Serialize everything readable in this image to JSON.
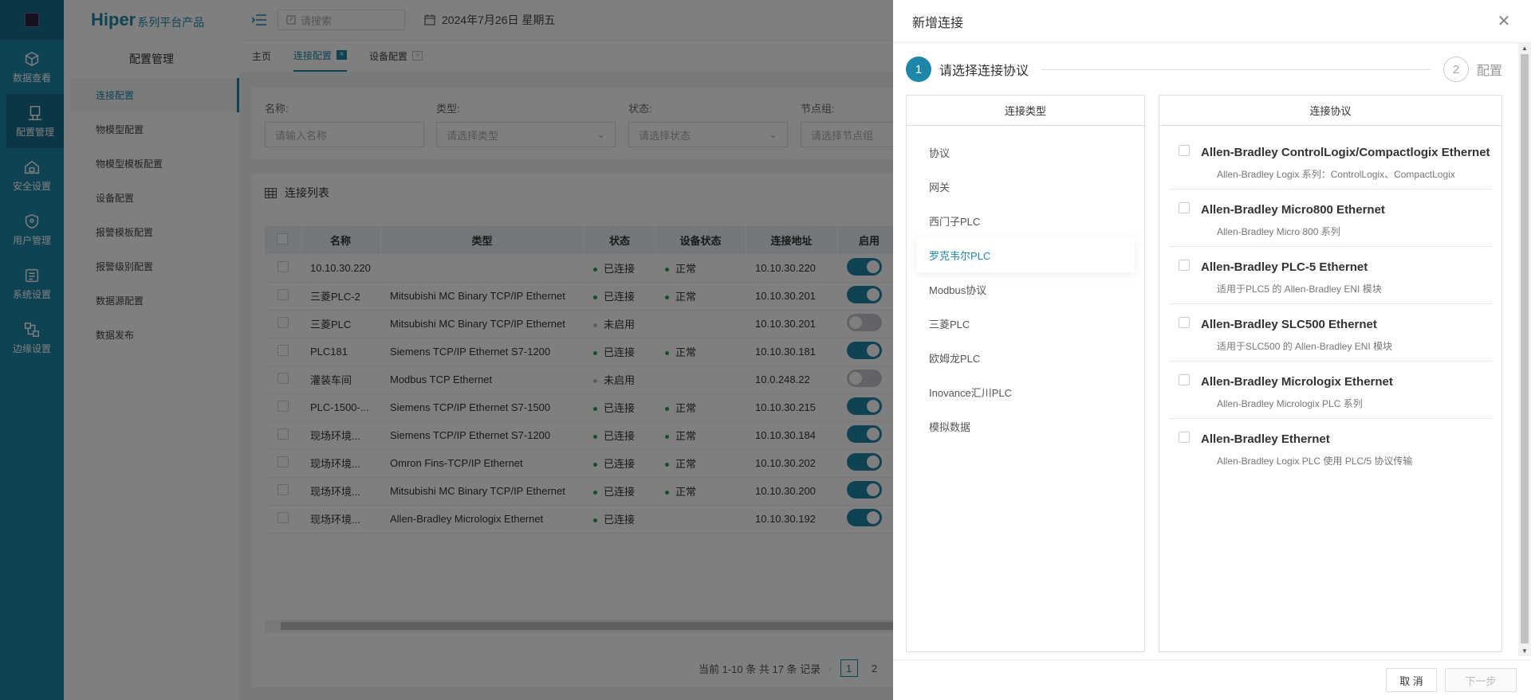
{
  "rail": {
    "items": [
      {
        "label": "数据查看",
        "icon": "cube-icon"
      },
      {
        "label": "配置管理",
        "icon": "config-icon"
      },
      {
        "label": "安全设置",
        "icon": "home-lock-icon"
      },
      {
        "label": "用户管理",
        "icon": "shield-icon"
      },
      {
        "label": "系统设置",
        "icon": "system-icon"
      },
      {
        "label": "边缘设置",
        "icon": "edge-icon"
      }
    ]
  },
  "brand": {
    "main": "Hiper",
    "sub": "系列平台产品"
  },
  "sidebar": {
    "title": "配置管理",
    "items": [
      {
        "label": "连接配置"
      },
      {
        "label": "物模型配置"
      },
      {
        "label": "物模型模板配置"
      },
      {
        "label": "设备配置"
      },
      {
        "label": "报警模板配置"
      },
      {
        "label": "报警级别配置"
      },
      {
        "label": "数据源配置"
      },
      {
        "label": "数据发布"
      }
    ]
  },
  "header": {
    "search_placeholder": "请搜索",
    "date": "2024年7月26日 星期五"
  },
  "tabs": [
    {
      "label": "主页"
    },
    {
      "label": "连接配置"
    },
    {
      "label": "设备配置"
    }
  ],
  "filters": {
    "name_label": "名称:",
    "name_placeholder": "请输入名称",
    "type_label": "类型:",
    "type_placeholder": "请选择类型",
    "status_label": "状态:",
    "status_placeholder": "请选择状态",
    "group_label": "节点组:",
    "group_placeholder": "请选择节点组"
  },
  "list": {
    "title": "连接列表",
    "columns": [
      "名称",
      "类型",
      "状态",
      "设备状态",
      "连接地址",
      "启用"
    ],
    "rows": [
      {
        "name": "10.10.30.220",
        "type": "",
        "status": "已连接",
        "dev": "正常",
        "addr": "10.10.30.220",
        "on": true
      },
      {
        "name": "三菱PLC-2",
        "type": "Mitsubishi MC Binary TCP/IP Ethernet",
        "status": "已连接",
        "dev": "正常",
        "addr": "10.10.30.201",
        "on": true
      },
      {
        "name": "三菱PLC",
        "type": "Mitsubishi MC Binary TCP/IP Ethernet",
        "status": "未启用",
        "dev": "",
        "addr": "10.10.30.201",
        "on": false
      },
      {
        "name": "PLC181",
        "type": "Siemens TCP/IP Ethernet S7-1200",
        "status": "已连接",
        "dev": "正常",
        "addr": "10.10.30.181",
        "on": true
      },
      {
        "name": "灌装车间",
        "type": "Modbus TCP Ethernet",
        "status": "未启用",
        "dev": "",
        "addr": "10.0.248.22",
        "on": false
      },
      {
        "name": "PLC-1500-...",
        "type": "Siemens TCP/IP Ethernet S7-1500",
        "status": "已连接",
        "dev": "正常",
        "addr": "10.10.30.215",
        "on": true
      },
      {
        "name": "现场环境...",
        "type": "Siemens TCP/IP Ethernet S7-1200",
        "status": "已连接",
        "dev": "正常",
        "addr": "10.10.30.184",
        "on": true
      },
      {
        "name": "现场环境...",
        "type": "Omron Fins-TCP/IP Ethernet",
        "status": "已连接",
        "dev": "正常",
        "addr": "10.10.30.202",
        "on": true
      },
      {
        "name": "现场环境...",
        "type": "Mitsubishi MC Binary TCP/IP Ethernet",
        "status": "已连接",
        "dev": "正常",
        "addr": "10.10.30.200",
        "on": true
      },
      {
        "name": "现场环境...",
        "type": "Allen-Bradley Micrologix Ethernet",
        "status": "已连接",
        "dev": "",
        "addr": "10.10.30.192",
        "on": true
      }
    ],
    "pager_text": "当前 1-10 条 共 17 条 记录",
    "pages": [
      "1",
      "2"
    ]
  },
  "drawer": {
    "title": "新增连接",
    "step1_num": "1",
    "step1_label": "请选择连接协议",
    "step2_num": "2",
    "step2_label": "配置",
    "type_header": "连接类型",
    "proto_header": "连接协议",
    "types": [
      "协议",
      "网关",
      "西门子PLC",
      "罗克韦尔PLC",
      "Modbus协议",
      "三菱PLC",
      "欧姆龙PLC",
      "Inovance汇川PLC",
      "模拟数据"
    ],
    "active_type_index": 3,
    "protocols": [
      {
        "name": "Allen-Bradley ControlLogix/Compactlogix Ethernet",
        "desc": "Allen-Bradley Logix 系列：ControlLogix、CompactLogix"
      },
      {
        "name": "Allen-Bradley Micro800 Ethernet",
        "desc": "Allen-Bradley Micro 800 系列"
      },
      {
        "name": "Allen-Bradley PLC-5 Ethernet",
        "desc": "适用于PLC5 的 Allen-Bradley ENI 模块"
      },
      {
        "name": "Allen-Bradley SLC500 Ethernet",
        "desc": "适用于SLC500 的 Allen-Bradley ENI 模块"
      },
      {
        "name": "Allen-Bradley Micrologix Ethernet",
        "desc": "Allen-Bradley Micrologix PLC 系列"
      },
      {
        "name": "Allen-Bradley Ethernet",
        "desc": "Allen-Bradley Logix PLC 使用 PLC/5 协议传输"
      }
    ],
    "cancel_label": "取 消",
    "next_label": "下一步"
  },
  "colors": {
    "accent": "#1e86a8",
    "ok": "#2c9b5b"
  }
}
